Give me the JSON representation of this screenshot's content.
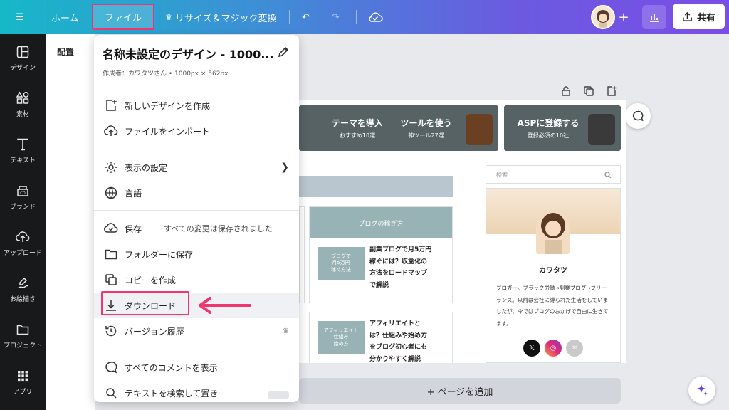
{
  "topbar": {
    "home": "ホーム",
    "file": "ファイル",
    "resize": "リサイズ＆マジック変換",
    "share": "共有"
  },
  "rail": [
    {
      "label": "デザイン",
      "icon": "layout-icon"
    },
    {
      "label": "素材",
      "icon": "shapes-icon"
    },
    {
      "label": "テキスト",
      "icon": "text-icon"
    },
    {
      "label": "ブランド",
      "icon": "brand-icon"
    },
    {
      "label": "アップロード",
      "icon": "upload-icon"
    },
    {
      "label": "お絵描き",
      "icon": "draw-icon"
    },
    {
      "label": "プロジェクト",
      "icon": "folder-icon"
    },
    {
      "label": "アプリ",
      "icon": "apps-icon"
    }
  ],
  "panel": {
    "label": "配置"
  },
  "menu": {
    "title": "名称未設定のデザイン - 1000...",
    "subtitle": "作成者：カワタツさん • 1000px × 562px",
    "items": {
      "new_design": "新しいデザインを作成",
      "import": "ファイルをインポート",
      "view_settings": "表示の設定",
      "language": "言語",
      "save": "保存",
      "save_status": "すべての変更は保存されました",
      "save_folder": "フォルダーに保存",
      "copy": "コピーを作成",
      "download": "ダウンロード",
      "version_history": "バージョン履歴",
      "show_comments": "すべてのコメントを表示",
      "find_replace": "テキストを検索して置き"
    }
  },
  "design": {
    "banners": [
      {
        "title": "テーマを導入",
        "sub": "おすすめ10選"
      },
      {
        "title": "ツールを使う",
        "sub": "神ツール27選"
      },
      {
        "title": "ASPに登録する",
        "sub": "登録必須の10社"
      }
    ],
    "column_head": "ブログの稼ぎ方",
    "posts": [
      {
        "thumb": "ブログで\n月5万円\n稼ぐ方法",
        "text": "副業ブログで月5万円\n稼ぐには？収益化の\n方法をロードマップ\nで解説"
      },
      {
        "thumb": "アフィリエイト\n仕組み\n始め方",
        "text": "アフィリエイトと\nは？仕組みや始め方\nをブログ初心者にも\n分かりやすく解説"
      }
    ],
    "search_placeholder": "検索",
    "profile_name": "カワタツ",
    "profile_desc": "ブロガー。ブラック労働→副業ブログ→フリーランス。以前は会社に縛られた生活をしていましたが、今ではブログのおかげで自由に生きてます。"
  },
  "add_page": "+ ページを追加",
  "colors": {
    "highlight": "#f0366f",
    "banner": "#566264",
    "teal": "#98b3b6"
  }
}
